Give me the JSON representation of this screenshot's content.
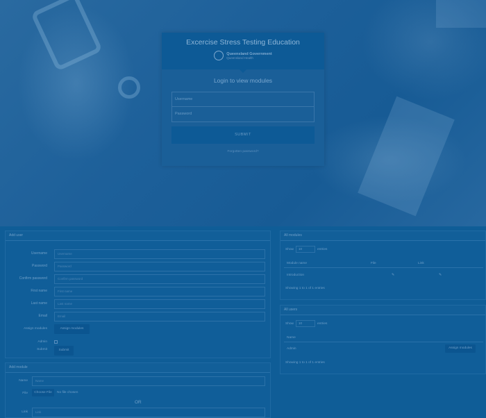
{
  "login": {
    "title": "Excercise Stress Testing Education",
    "logo_line1": "Queensland Government",
    "logo_line2": "Queensland Health",
    "subtitle": "Login to view modules",
    "username_placeholder": "Username",
    "password_placeholder": "Password",
    "submit_label": "SUBMIT",
    "forgot_label": "Forgotten password?"
  },
  "add_user": {
    "header": "Add user",
    "fields": [
      {
        "label": "Username",
        "value": "Username"
      },
      {
        "label": "Password",
        "value": "Password"
      },
      {
        "label": "Confirm password",
        "value": "Confirm password"
      },
      {
        "label": "First name",
        "value": "First name"
      },
      {
        "label": "Last name",
        "value": "Last name"
      },
      {
        "label": "Email",
        "value": "Email"
      }
    ],
    "assign_label": "Assign modules",
    "assign_button": "Assign modules",
    "admin_label": "Admin",
    "submit_label": "Submit"
  },
  "add_module": {
    "header": "Add module",
    "name_label": "Name",
    "name_value": "Name",
    "file_label": "File",
    "choose_file": "Choose File",
    "no_file": "No file chosen",
    "or_text": "OR",
    "link_label": "Link",
    "link_value": "Link"
  },
  "all_modules": {
    "header": "All modules",
    "show_label": "Show",
    "show_value": "10",
    "entries_label": "entries",
    "col_name": "Module name",
    "col_file": "File",
    "col_link": "Link",
    "row_name": "Introduction",
    "info": "Showing 1 to 1 of 1 entries"
  },
  "all_users": {
    "header": "All users",
    "show_label": "Show",
    "show_value": "10",
    "entries_label": "entries",
    "col_name": "Name",
    "row_name": "Admin",
    "row_button": "Assign modules",
    "info": "Showing 1 to 1 of 1 entries"
  }
}
